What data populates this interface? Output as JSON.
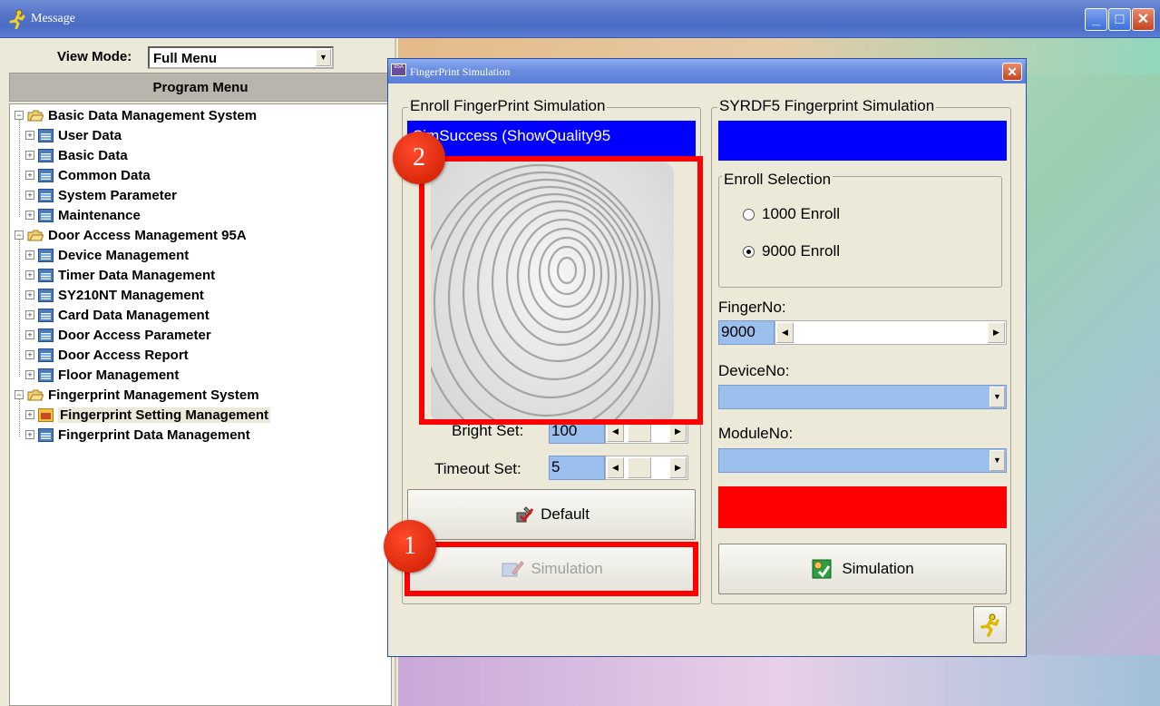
{
  "window": {
    "title": "Message"
  },
  "left": {
    "view_mode_label": "View Mode:",
    "view_mode_value": "Full Menu",
    "menu_header": "Program Menu",
    "tree": [
      {
        "label": "Basic Data Management System",
        "level": 0
      },
      {
        "label": "User Data",
        "level": 1
      },
      {
        "label": "Basic Data",
        "level": 1
      },
      {
        "label": "Common Data",
        "level": 1
      },
      {
        "label": "System Parameter",
        "level": 1
      },
      {
        "label": "Maintenance",
        "level": 1
      },
      {
        "label": "Door Access Management 95A",
        "level": 0
      },
      {
        "label": "Device Management",
        "level": 1
      },
      {
        "label": "Timer Data Management",
        "level": 1
      },
      {
        "label": "SY210NT Management",
        "level": 1
      },
      {
        "label": "Card Data Management",
        "level": 1
      },
      {
        "label": "Door Access Parameter",
        "level": 1
      },
      {
        "label": "Door Access Report",
        "level": 1
      },
      {
        "label": "Floor Management",
        "level": 1
      },
      {
        "label": "Fingerprint Management System",
        "level": 0
      },
      {
        "label": "Fingerprint Setting Management",
        "level": 1,
        "selected": true
      },
      {
        "label": "Fingerprint Data Management",
        "level": 1
      }
    ]
  },
  "dialog": {
    "title": "FingerPrint Simulation",
    "enroll": {
      "group_title": "Enroll FingerPrint Simulation",
      "status_text": "SimSuccess (ShowQuality95",
      "bright_label": "Bright Set:",
      "bright_value": "100",
      "timeout_label": "Timeout Set:",
      "timeout_value": "5",
      "default_button": "Default",
      "simulation_button": "Simulation"
    },
    "syrdf5": {
      "group_title": "SYRDF5 Fingerprint Simulation",
      "enroll_selection_title": "Enroll Selection",
      "option_1000": "1000 Enroll",
      "option_9000": "9000 Enroll",
      "selected_option": "9000 Enroll",
      "fingerno_label": "FingerNo:",
      "fingerno_value": "9000",
      "deviceno_label": "DeviceNo:",
      "moduleno_label": "ModuleNo:",
      "simulation_button": "Simulation"
    }
  },
  "annotations": {
    "badge_1": "1",
    "badge_2": "2"
  },
  "colors": {
    "status_blue": "#0000ff",
    "status_red": "#ff0000",
    "annotation_red": "#ff0000"
  }
}
